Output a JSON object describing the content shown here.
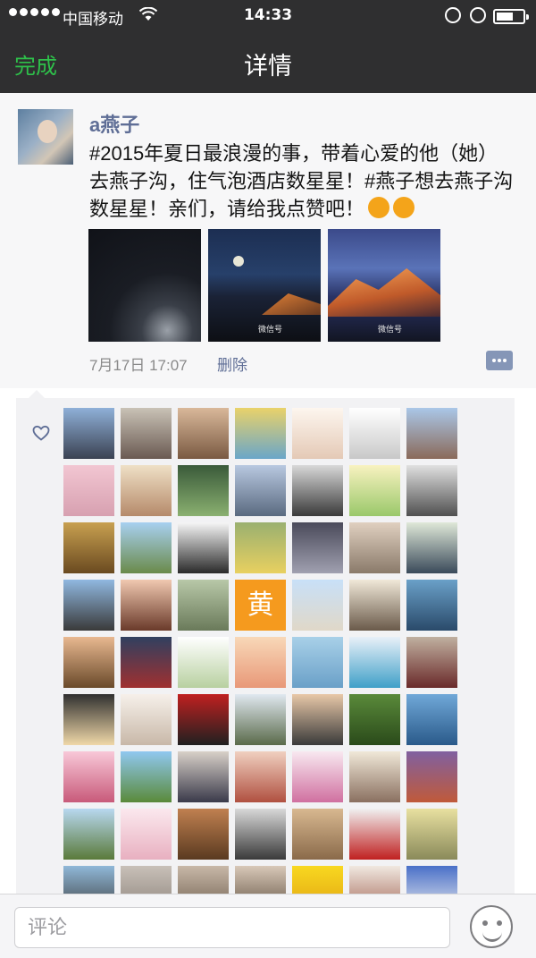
{
  "status_bar": {
    "carrier": "中国移动",
    "time": "14:33"
  },
  "nav": {
    "done_label": "完成",
    "title": "详情"
  },
  "post": {
    "username": "a燕子",
    "text": "#2015年夏日最浪漫的事，带着心爱的他（她）去燕子沟，住气泡酒店数星星！#燕子想去燕子沟数星星！亲们，请给我点赞吧！",
    "date": "7月17日 17:07",
    "delete_label": "删除"
  },
  "likes": {
    "avatars": [
      {
        "bg": "linear-gradient(180deg,#8fb0d8,#3b4252)"
      },
      {
        "bg": "linear-gradient(180deg,#c9c2b6,#6a5a52)"
      },
      {
        "bg": "linear-gradient(180deg,#d9b89a,#7a5a42)"
      },
      {
        "bg": "linear-gradient(180deg,#e9d26a,#6aa6c8)"
      },
      {
        "bg": "linear-gradient(180deg,#fdf6ef,#e4c9b6)"
      },
      {
        "bg": "linear-gradient(180deg,#ffffff,#c8c8c8)"
      },
      {
        "bg": "linear-gradient(180deg,#aac7e8,#8a6a5a)"
      },
      {
        "bg": "linear-gradient(180deg,#f2c6d2,#d7a0b0)"
      },
      {
        "bg": "linear-gradient(180deg,#efe0c6,#b58a6a)"
      },
      {
        "bg": "linear-gradient(180deg,#3a5a3a,#8ab070)"
      },
      {
        "bg": "linear-gradient(180deg,#b8c8e0,#5a6a80)"
      },
      {
        "bg": "linear-gradient(180deg,#d8d8d8,#3a3a3a)"
      },
      {
        "bg": "linear-gradient(180deg,#f8f2c0,#9ac86a)"
      },
      {
        "bg": "linear-gradient(180deg,#e0e0e0,#505050)"
      },
      {
        "bg": "linear-gradient(180deg,#c8a050,#6a4a20)"
      },
      {
        "bg": "linear-gradient(180deg,#a8d0f0,#6a8a4a)"
      },
      {
        "bg": "linear-gradient(180deg,#f6f6f6,#2a2a2a)"
      },
      {
        "bg": "linear-gradient(180deg,#9ab070,#e8d060)"
      },
      {
        "bg": "linear-gradient(180deg,#4a4a5a,#a0a0b0)"
      },
      {
        "bg": "linear-gradient(180deg,#e0d0c0,#8a7a6a)"
      },
      {
        "bg": "linear-gradient(180deg,#dfe8d8,#3a4a5a)"
      },
      {
        "bg": "linear-gradient(180deg,#90b8e0,#3a3a3a)"
      },
      {
        "bg": "linear-gradient(180deg,#f0c8b0,#6a3a2a)"
      },
      {
        "bg": "linear-gradient(180deg,#b8c8a8,#6a7a5a)"
      },
      {
        "text": "黄"
      },
      {
        "bg": "linear-gradient(180deg,#c8e0f8,#e0d8c8)"
      },
      {
        "bg": "linear-gradient(180deg,#f0e8d8,#6a5a4a)"
      },
      {
        "bg": "linear-gradient(180deg,#6aa0c8,#2a4a6a)"
      },
      {
        "bg": "linear-gradient(180deg,#e8b890,#6a4a2a)"
      },
      {
        "bg": "linear-gradient(180deg,#304060,#a03030)"
      },
      {
        "bg": "linear-gradient(180deg,#ffffff,#b8d0a0)"
      },
      {
        "bg": "linear-gradient(180deg,#f8d8b8,#e89878)"
      },
      {
        "bg": "linear-gradient(180deg,#a8d0e8,#6aa0c8)"
      },
      {
        "bg": "linear-gradient(180deg,#e8f0f8,#40a0c8)"
      },
      {
        "bg": "linear-gradient(180deg,#c0b0a0,#6a2a2a)"
      },
      {
        "bg": "linear-gradient(180deg,#303030,#f0d8a8)"
      },
      {
        "bg": "linear-gradient(180deg,#f6f0ea,#c8b8a8)"
      },
      {
        "bg": "linear-gradient(180deg,#c02020,#202020)"
      },
      {
        "bg": "linear-gradient(180deg,#e0e8f0,#5a6a4a)"
      },
      {
        "bg": "linear-gradient(180deg,#e8c8a8,#3a3a3a)"
      },
      {
        "bg": "linear-gradient(180deg,#5a8a3a,#2a4a1a)"
      },
      {
        "bg": "linear-gradient(180deg,#70a8d8,#2a5a8a)"
      },
      {
        "bg": "linear-gradient(180deg,#f8c8d8,#c85a7a)"
      },
      {
        "bg": "linear-gradient(180deg,#90c8f0,#5a8a3a)"
      },
      {
        "bg": "linear-gradient(180deg,#d8d0c8,#3a3a4a)"
      },
      {
        "bg": "linear-gradient(180deg,#f0d0c0,#b05040)"
      },
      {
        "bg": "linear-gradient(180deg,#f8e8f0,#d070a0)"
      },
      {
        "bg": "linear-gradient(180deg,#f0e8d8,#8a7060)"
      },
      {
        "bg": "linear-gradient(180deg,#8060a0,#c05a3a)"
      },
      {
        "bg": "linear-gradient(180deg,#b8d8f0,#5a7a3a)"
      },
      {
        "bg": "linear-gradient(180deg,#fbe8ee,#e8b0c0)"
      },
      {
        "bg": "linear-gradient(180deg,#c08050,#5a3a20)"
      },
      {
        "bg": "linear-gradient(180deg,#d8d8d8,#3a3a3a)"
      },
      {
        "bg": "linear-gradient(180deg,#d8b890,#8a6a4a)"
      },
      {
        "bg": "linear-gradient(180deg,#f0f0f0,#c02020)"
      },
      {
        "bg": "linear-gradient(180deg,#e8e0a0,#8a8a5a)"
      },
      {
        "bg": "linear-gradient(180deg,#90b8d8,#3a3a3a)"
      },
      {
        "bg": "linear-gradient(180deg,#c8c0b8,#8a8078)"
      },
      {
        "bg": "linear-gradient(180deg,#c8b8a8,#6a5a4a)"
      },
      {
        "bg": "linear-gradient(180deg,#d8c8b8,#5a4a3a)"
      },
      {
        "bg": "linear-gradient(180deg,#f8d820,#e0a010)"
      },
      {
        "bg": "linear-gradient(180deg,#f0e8e0,#a06050)"
      },
      {
        "bg": "linear-gradient(180deg,#4a70c8,#f0f0f0)"
      }
    ]
  },
  "comment_bar": {
    "placeholder": "评论"
  }
}
